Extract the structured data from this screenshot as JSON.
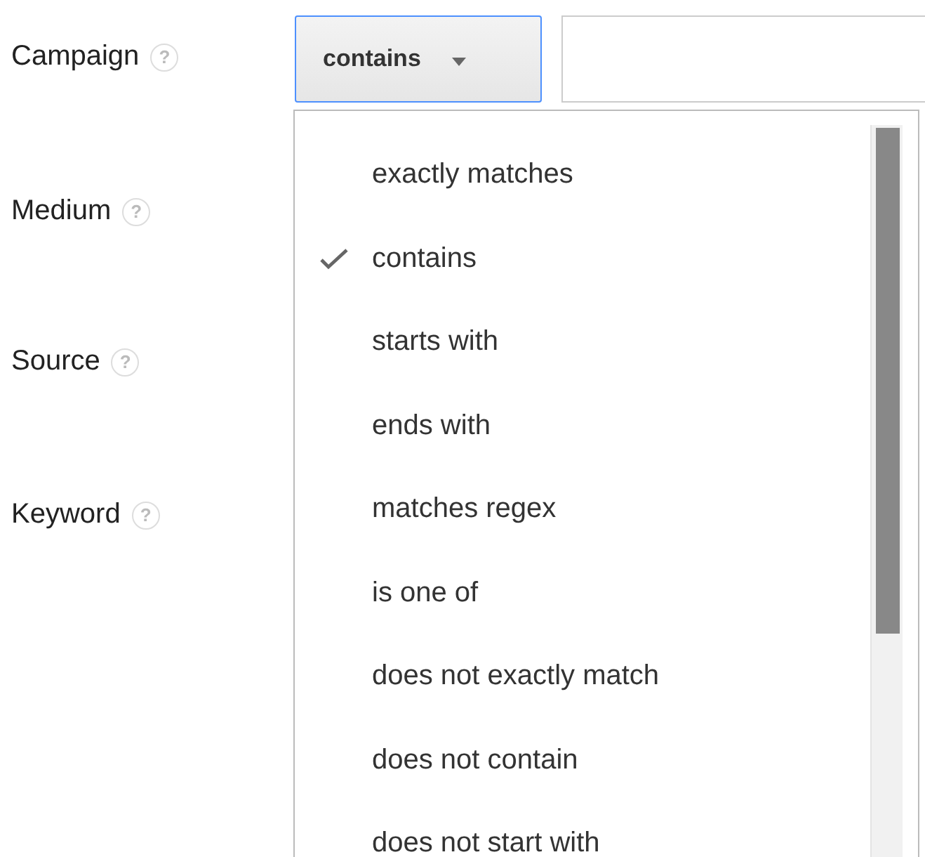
{
  "fields": [
    {
      "label": "Campaign",
      "help": "?"
    },
    {
      "label": "Medium",
      "help": "?"
    },
    {
      "label": "Source",
      "help": "?"
    },
    {
      "label": "Keyword",
      "help": "?"
    }
  ],
  "match_dropdown": {
    "value": "contains",
    "expanded": true
  },
  "menu_items": [
    {
      "label": "exactly matches",
      "selected": false
    },
    {
      "label": "contains",
      "selected": true
    },
    {
      "label": "starts with",
      "selected": false
    },
    {
      "label": "ends with",
      "selected": false
    },
    {
      "label": "matches regex",
      "selected": false
    },
    {
      "label": "is one of",
      "selected": false
    },
    {
      "label": "does not exactly match",
      "selected": false
    },
    {
      "label": "does not contain",
      "selected": false
    },
    {
      "label": "does not start with",
      "selected": false
    }
  ]
}
